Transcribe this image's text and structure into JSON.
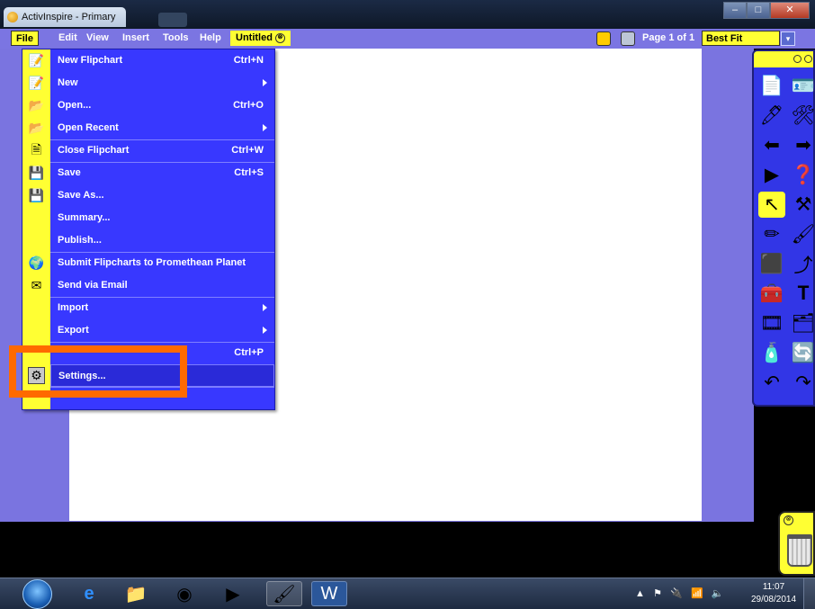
{
  "window": {
    "title": "ActivInspire - Primary",
    "minimize_label": "–",
    "maximize_label": "□",
    "close_label": "✕"
  },
  "menubar": {
    "items": [
      {
        "label": "File"
      },
      {
        "label": "Edit"
      },
      {
        "label": "View"
      },
      {
        "label": "Insert"
      },
      {
        "label": "Tools"
      },
      {
        "label": "Help"
      }
    ],
    "document_tab": "Untitled",
    "close_tab_glyph": "⊗",
    "page_indicator": "Page 1 of 1",
    "zoom_value": "Best Fit",
    "zoom_arrow": "▾"
  },
  "file_menu": {
    "items": [
      {
        "label": "New Flipchart",
        "shortcut": "Ctrl+N"
      },
      {
        "label": "New",
        "shortcut": ""
      },
      {
        "label": "Open...",
        "shortcut": "Ctrl+O"
      },
      {
        "label": "Open Recent",
        "shortcut": ""
      },
      {
        "label": "Close Flipchart",
        "shortcut": "Ctrl+W"
      },
      {
        "label": "Save",
        "shortcut": "Ctrl+S"
      },
      {
        "label": "Save As...",
        "shortcut": ""
      },
      {
        "label": "Summary...",
        "shortcut": ""
      },
      {
        "label": "Publish...",
        "shortcut": ""
      },
      {
        "label": "Submit Flipcharts to Promethean Planet",
        "shortcut": ""
      },
      {
        "label": "Send via Email",
        "shortcut": ""
      },
      {
        "label": "Import",
        "shortcut": ""
      },
      {
        "label": "Export",
        "shortcut": ""
      },
      {
        "label": "",
        "shortcut": "Ctrl+P"
      },
      {
        "label": "Settings...",
        "shortcut": ""
      }
    ]
  },
  "toolbox": {
    "tools": [
      "page-browser",
      "property-browser",
      "annotate-desktop",
      "tools-menu",
      "previous-page",
      "next-page",
      "play",
      "help",
      "select",
      "tools",
      "pen",
      "fill",
      "shape",
      "connector",
      "clipart",
      "text",
      "media",
      "resource",
      "clear",
      "reset-page",
      "undo",
      "redo"
    ]
  },
  "taskbar": {
    "apps": [
      "internet-explorer",
      "file-explorer",
      "chrome",
      "media-player",
      "activinspire",
      "word"
    ],
    "clock_time": "11:07",
    "clock_date": "29/08/2014"
  },
  "colors": {
    "menu_blue": "#3838ff",
    "workspace_purple": "#7a74e0",
    "accent_yellow": "#ffff33",
    "highlight_orange": "#ff6a00"
  }
}
